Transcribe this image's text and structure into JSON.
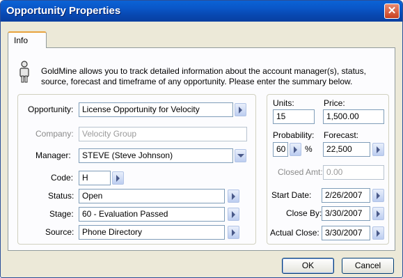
{
  "window": {
    "title": "Opportunity Properties",
    "close_glyph": "✕"
  },
  "tabs": [
    {
      "label": "Info"
    }
  ],
  "description": "GoldMine allows you to track detailed information about the account manager(s), status, source, forecast and timeframe of any opportunity.  Please enter the summary below.",
  "left": {
    "opportunity": {
      "label": "Opportunity:",
      "value": "License Opportunity for Velocity"
    },
    "company": {
      "label": "Company:",
      "value": "Velocity Group"
    },
    "manager": {
      "label": "Manager:",
      "value": "STEVE (Steve Johnson)"
    },
    "code": {
      "label": "Code:",
      "value": "H"
    },
    "status": {
      "label": "Status:",
      "value": "Open"
    },
    "stage": {
      "label": "Stage:",
      "value": "60 - Evaluation Passed"
    },
    "source": {
      "label": "Source:",
      "value": "Phone Directory"
    }
  },
  "right": {
    "units": {
      "label": "Units:",
      "value": "15"
    },
    "price": {
      "label": "Price:",
      "value": "1,500.00"
    },
    "probability": {
      "label": "Probability:",
      "value": "60",
      "suffix": "%"
    },
    "forecast": {
      "label": "Forecast:",
      "value": "22,500"
    },
    "closed_amt": {
      "label": "Closed Amt:",
      "value": "0.00"
    },
    "start_date": {
      "label": "Start Date:",
      "value": "2/26/2007"
    },
    "close_by": {
      "label": "Close By:",
      "value": "3/30/2007"
    },
    "actual_close": {
      "label": "Actual Close:",
      "value": "3/30/2007"
    }
  },
  "buttons": {
    "ok": "OK",
    "cancel": "Cancel"
  },
  "colors": {
    "titlebar": "#0a57c8",
    "dialog_bg": "#ece9d8",
    "tab_accent": "#e8a33d"
  },
  "icons": {
    "info": "person-info-icon",
    "close": "close-icon",
    "arrow": "arrow-right-icon",
    "dropdown": "chevron-down-icon"
  }
}
